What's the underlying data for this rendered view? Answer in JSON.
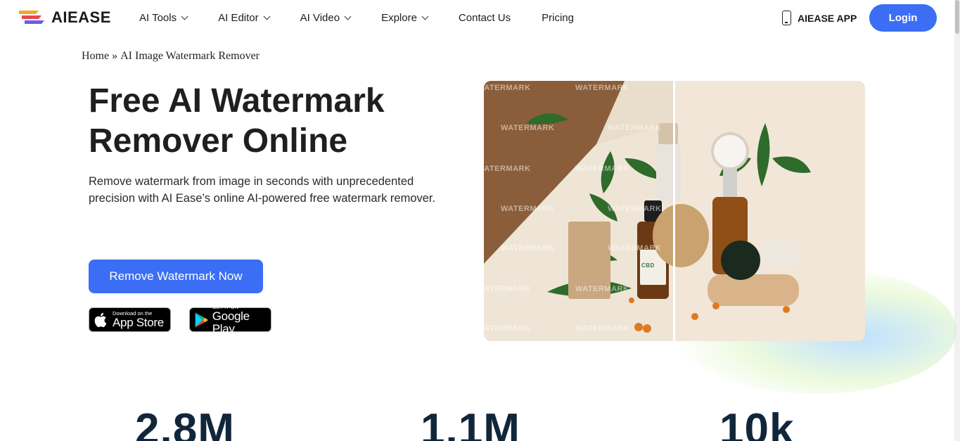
{
  "header": {
    "logo_text": "AIEASE",
    "nav": [
      {
        "label": "AI Tools",
        "dropdown": true
      },
      {
        "label": "AI Editor",
        "dropdown": true
      },
      {
        "label": "AI Video",
        "dropdown": true
      },
      {
        "label": "Explore",
        "dropdown": true
      },
      {
        "label": "Contact Us",
        "dropdown": false
      },
      {
        "label": "Pricing",
        "dropdown": false
      }
    ],
    "app_link": "AIEASE APP",
    "login": "Login"
  },
  "breadcrumb": {
    "home": "Home",
    "separator": "»",
    "current": "AI Image Watermark Remover"
  },
  "hero": {
    "title_line1": "Free AI Watermark",
    "title_line2": "Remover Online",
    "description": "Remove watermark from image in seconds with unprecedented precision with AI Ease’s online AI-powered free watermark remover.",
    "cta": "Remove Watermark Now",
    "app_store": {
      "small": "Download on the",
      "big": "App Store"
    },
    "google_play": {
      "small": "GET IT ON",
      "big": "Google Play"
    }
  },
  "compare_image": {
    "watermark_text": "WATERMARK",
    "bottle_label": "CBD"
  },
  "stats": [
    "2.8M",
    "1.1M",
    "10k"
  ],
  "colors": {
    "accent": "#3b6ef5",
    "text_dark": "#1f1f1f",
    "stat_color": "#12263a"
  }
}
